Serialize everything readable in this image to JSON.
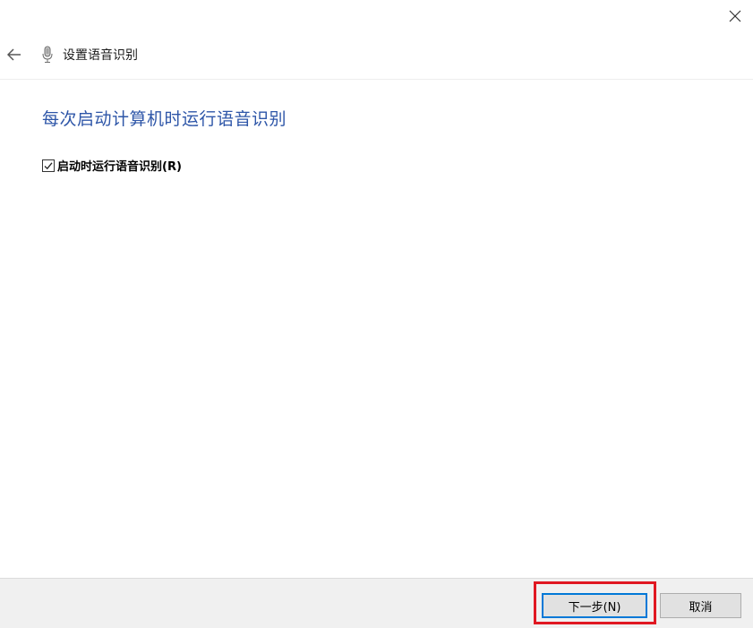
{
  "window": {
    "close_icon": "close-icon"
  },
  "header": {
    "back_icon": "back-arrow-icon",
    "app_icon": "microphone-icon",
    "title": "设置语音识别"
  },
  "content": {
    "heading": "每次启动计算机时运行语音识别",
    "checkbox": {
      "label": "启动时运行语音识别(R)",
      "checked": true
    }
  },
  "footer": {
    "next_label": "下一步(N)",
    "cancel_label": "取消",
    "highlight_color": "#e01822",
    "accent_color": "#0078d7"
  }
}
